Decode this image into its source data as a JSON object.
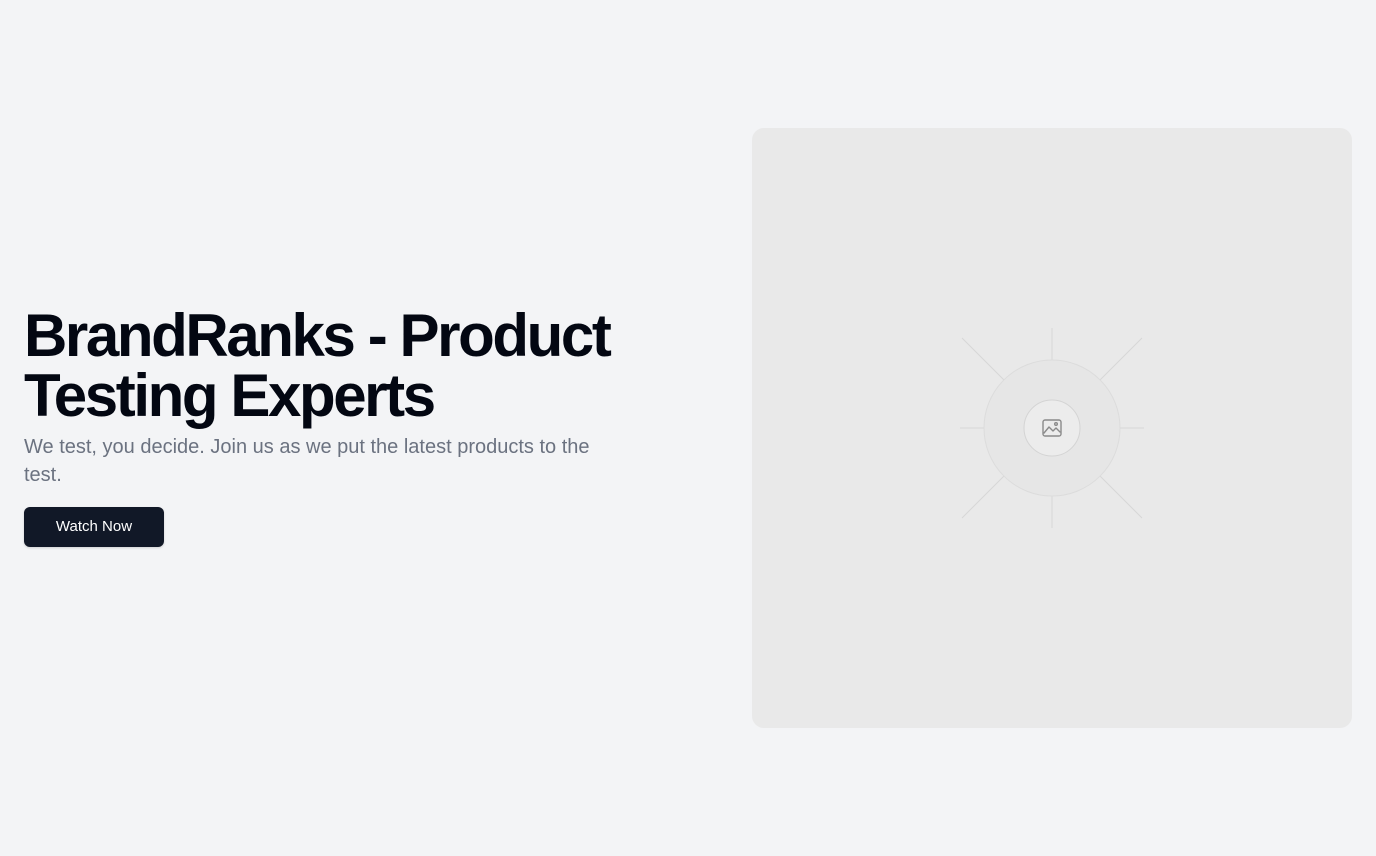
{
  "hero": {
    "title": "BrandRanks - Product Testing Experts",
    "subtitle": "We test, you decide. Join us as we put the latest products to the test.",
    "cta_label": "Watch Now"
  },
  "media": {
    "icon": "image-placeholder-icon"
  },
  "colors": {
    "background": "#f3f4f6",
    "title": "#030712",
    "subtitle": "#6b7280",
    "button_bg": "#111827",
    "button_text": "#ffffff",
    "placeholder_bg": "#e9e9e9"
  }
}
